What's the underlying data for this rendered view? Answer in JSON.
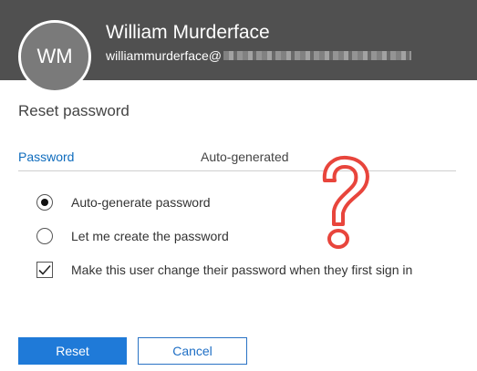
{
  "user": {
    "initials": "WM",
    "name": "William Murderface",
    "email_prefix": "williammurderface@"
  },
  "panel": {
    "title": "Reset password"
  },
  "tabs": {
    "password": "Password",
    "auto_generated": "Auto-generated"
  },
  "options": {
    "auto_generate": "Auto-generate password",
    "create_own": "Let me create the password",
    "force_change": "Make this user change their password when they first sign in"
  },
  "state": {
    "selected_option": "auto_generate",
    "force_change_checked": true
  },
  "buttons": {
    "reset": "Reset",
    "cancel": "Cancel"
  },
  "colors": {
    "header_bg": "#505050",
    "accent": "#1f7ad8",
    "annotation": "#e8453c"
  }
}
